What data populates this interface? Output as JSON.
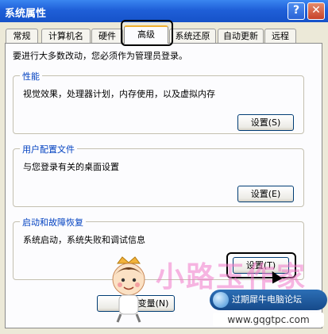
{
  "window": {
    "title": "系统属性",
    "help_glyph": "?",
    "close_glyph": "✕"
  },
  "tabs": [
    {
      "label": "常规",
      "active": false
    },
    {
      "label": "计算机名",
      "active": false
    },
    {
      "label": "硬件",
      "active": false
    },
    {
      "label": "高级",
      "active": true
    },
    {
      "label": "系统还原",
      "active": false
    },
    {
      "label": "自动更新",
      "active": false
    },
    {
      "label": "远程",
      "active": false
    }
  ],
  "advanced": {
    "intro": "要进行大多数改动，您必须作为管理员登录。",
    "performance": {
      "title": "性能",
      "description": "视觉效果，处理器计划，内存使用，以及虚拟内存",
      "button": "设置(S)"
    },
    "user_profiles": {
      "title": "用户配置文件",
      "description": "与您登录有关的桌面设置",
      "button": "设置(E)"
    },
    "startup_recovery": {
      "title": "启动和故障恢复",
      "description": "系统启动，系统失败和调试信息",
      "button": "设置(T)"
    }
  },
  "bottom": {
    "env_button": "变量(N)"
  },
  "watermark": {
    "logo": "小路玉作家",
    "badge": "过期犀牛电脑论坛",
    "url": "www.gqgtpc.com"
  },
  "colors": {
    "titlebar": "#1f5fd8",
    "group_title": "#0040c0",
    "active_tab_accent": "#f0b030"
  }
}
